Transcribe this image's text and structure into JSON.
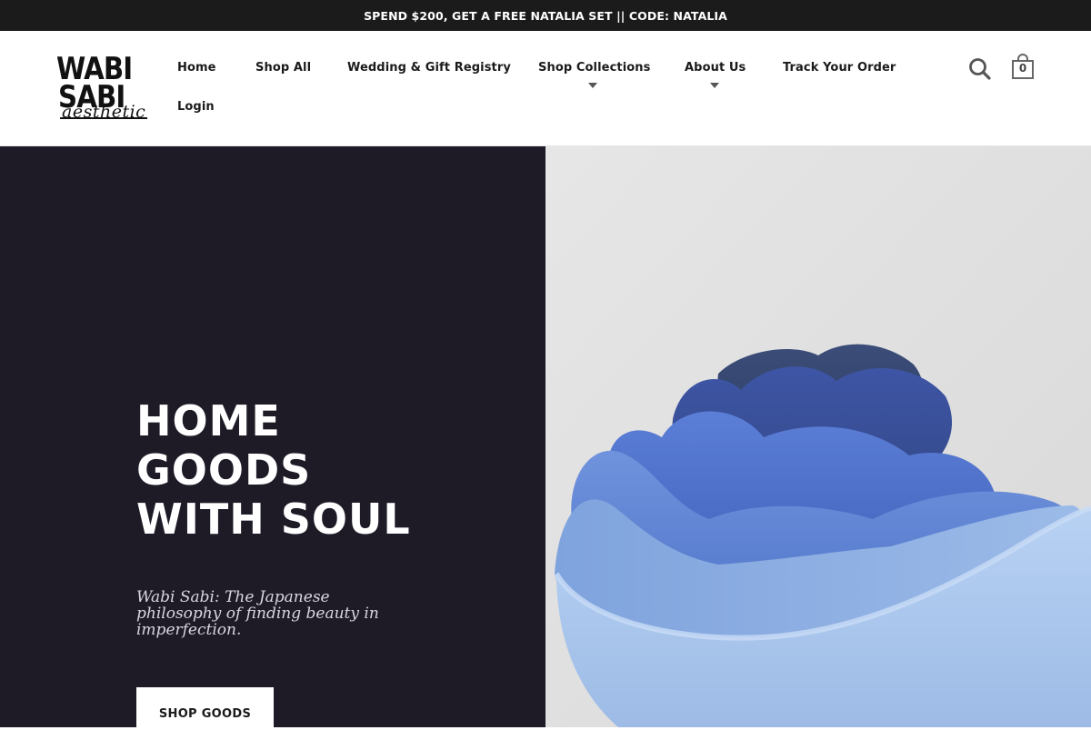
{
  "announcement": {
    "text": "SPEND $200, GET A FREE NATALIA SET || CODE: NATALIA"
  },
  "logo": {
    "line1": "WABI",
    "line2": "SABI",
    "line3": "aesthetic"
  },
  "nav": {
    "home": "Home",
    "shop_all": "Shop All",
    "registry": "Wedding & Gift Registry",
    "collections": "Shop Collections",
    "about": "About Us",
    "track": "Track Your Order",
    "login": "Login"
  },
  "icons": {
    "search": "search-icon",
    "cart": "shopping-bag-icon",
    "dropdown": "caret-down-icon"
  },
  "cart": {
    "count": "0"
  },
  "hero": {
    "title": "HOME\nGOODS\nWITH SOUL",
    "subtitle": "Wabi Sabi: The Japanese philosophy of finding beauty in imperfection.",
    "button_label": "SHOP GOODS",
    "image": "nested-blue-ceramic-bowls"
  },
  "colors": {
    "announcement_bg": "#1b1b1b",
    "hero_dark": "#1e1b27",
    "image_bg": "#e2e2e2",
    "bowl_light": "#a6c4ec",
    "bowl_mid": "#4f6fc9",
    "bowl_dark": "#3a4f8a"
  }
}
